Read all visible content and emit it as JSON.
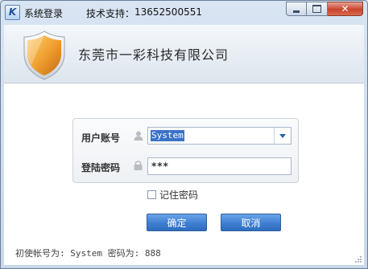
{
  "window": {
    "title": "系统登录",
    "support_label": "技术支持：",
    "support_phone": "13652500551",
    "icon": "app-logo-icon"
  },
  "banner": {
    "company": "东莞市一彩科技有限公司",
    "icon": "shield-icon"
  },
  "form": {
    "user_label": "用户账号",
    "user_value": "System",
    "password_label": "登陆密码",
    "password_value": "***",
    "remember_label": "记住密码"
  },
  "buttons": {
    "ok": "确定",
    "cancel": "取消"
  },
  "hint": "初使帐号为: System 密码为: 888",
  "colors": {
    "accent": "#3f7fd2",
    "close": "#c9442c",
    "shield": "#f0a030"
  }
}
